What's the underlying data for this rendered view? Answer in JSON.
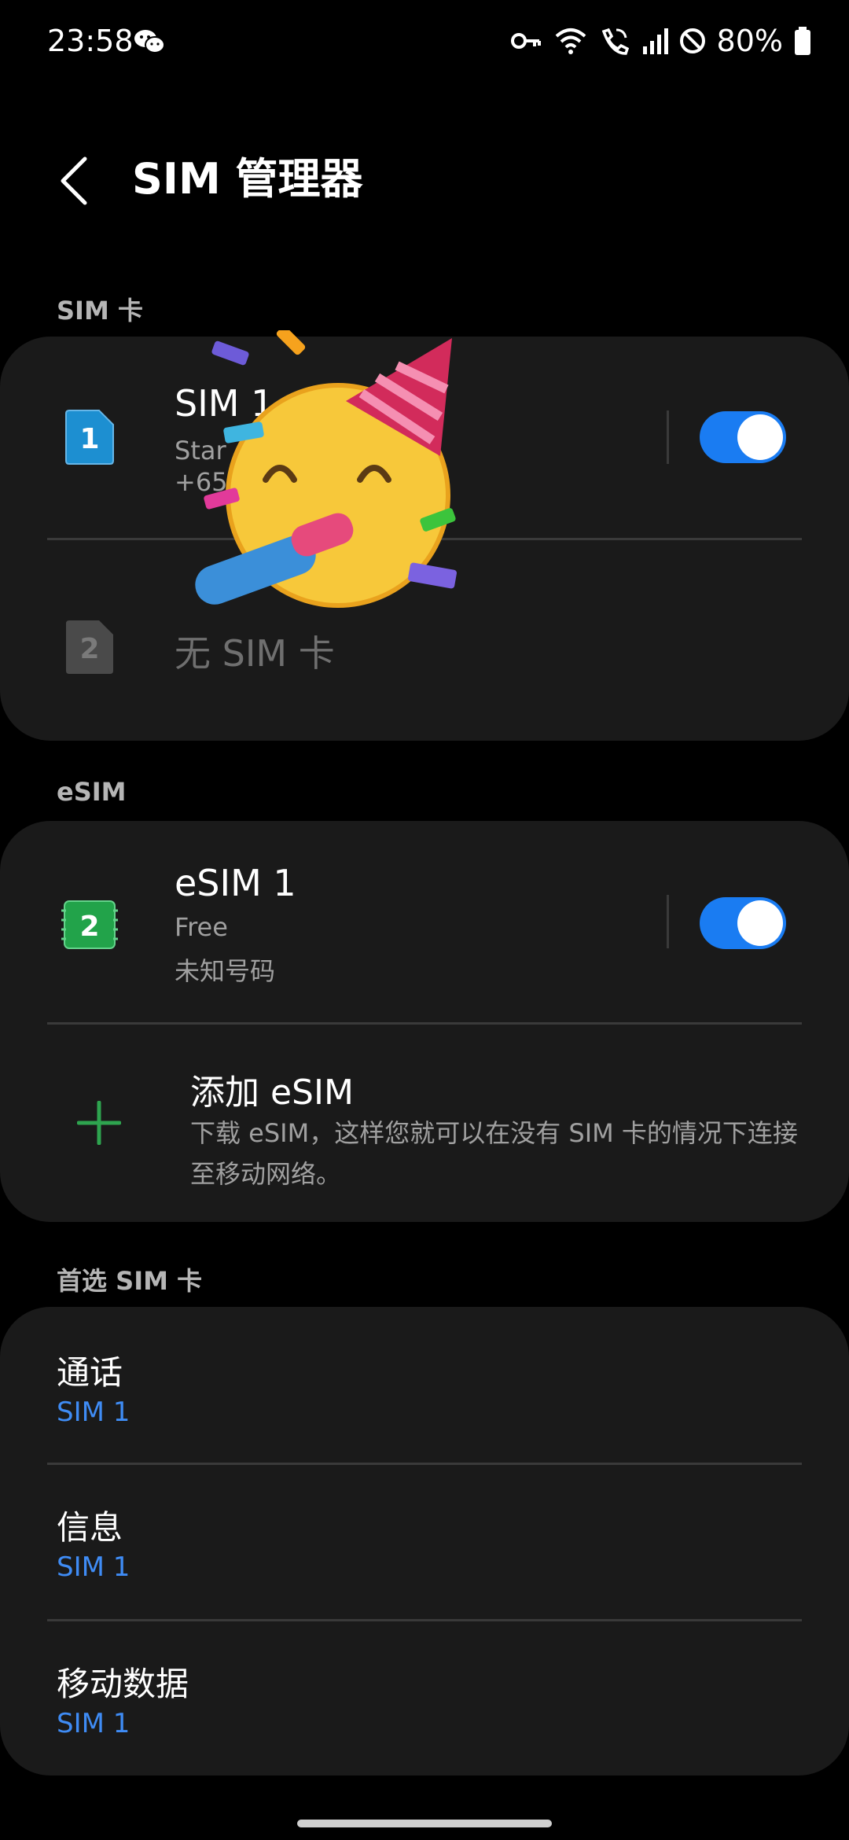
{
  "status_bar": {
    "time": "23:58",
    "battery": "80%",
    "icons": [
      "wechat-icon",
      "key-icon",
      "wifi-icon",
      "wifi-calling-icon",
      "signal-icon",
      "do-not-disturb-icon",
      "battery-icon"
    ]
  },
  "header": {
    "title": "SIM 管理器",
    "back_icon": "chevron-left-icon"
  },
  "sections": {
    "sim_cards": "SIM 卡",
    "esim": "eSIM",
    "preferred": "首选 SIM 卡"
  },
  "sim_cards": [
    {
      "slot": "1",
      "name": "SIM 1",
      "carrier": "Star",
      "number": "+65",
      "enabled": true,
      "color": "#1d8fd1"
    },
    {
      "slot": "2",
      "name": "无 SIM 卡",
      "color": "#4a4a4a"
    }
  ],
  "esim": {
    "slot": "2",
    "name": "eSIM 1",
    "carrier": "Free",
    "number": "未知号码",
    "enabled": true,
    "color": "#22a34a",
    "add_title": "添加 eSIM",
    "add_description": "下载 eSIM，这样您就可以在没有 SIM 卡的情况下连接至移动网络。"
  },
  "preferred": [
    {
      "label": "通话",
      "value": "SIM 1"
    },
    {
      "label": "信息",
      "value": "SIM 1"
    },
    {
      "label": "移动数据",
      "value": "SIM 1"
    }
  ],
  "colors": {
    "accent": "#1a7cf2",
    "link": "#3f8cf5",
    "card": "#1a1a1a",
    "background": "#000000"
  }
}
